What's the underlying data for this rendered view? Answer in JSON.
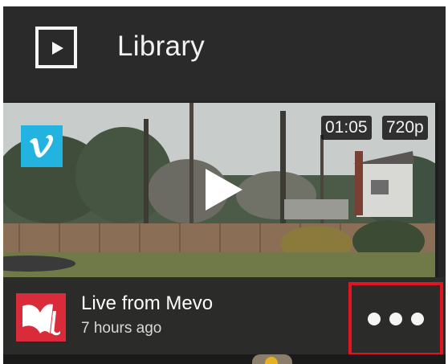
{
  "header": {
    "title": "Library",
    "icon": "library-play-icon"
  },
  "video": {
    "duration": "01:05",
    "quality": "720p",
    "source_icon": "vimeo-icon",
    "title": "Live from Mevo",
    "time_ago": "7 hours ago",
    "more_icon": "more-dots-icon"
  },
  "colors": {
    "background": "#262626",
    "vimeo": "#22b3e1",
    "mevo_brand": "#d92b3a",
    "highlight": "#e1141f"
  }
}
